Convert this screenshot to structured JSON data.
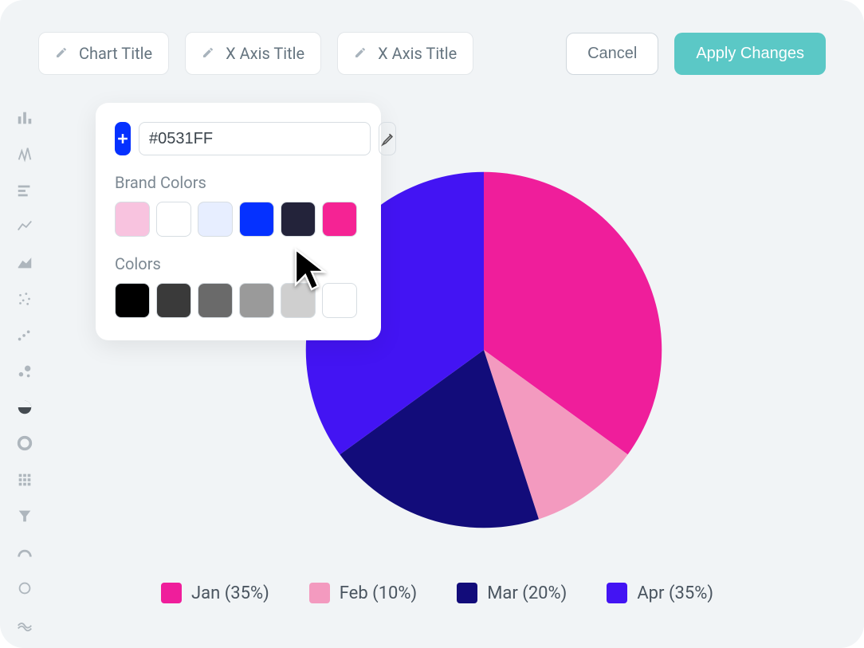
{
  "topbar": {
    "chart_title_placeholder": "Chart Title",
    "x_axis_title_placeholder": "X Axis Title",
    "x_axis_title_placeholder_2": "X Axis Title",
    "cancel_label": "Cancel",
    "apply_label": "Apply Changes"
  },
  "popover": {
    "hex_value": "#0531FF",
    "brand_colors_label": "Brand Colors",
    "brand_colors": [
      "#F8C3DF",
      "#FFFFFF",
      "#E7EEFF",
      "#0531FF",
      "#23233A",
      "#F52394"
    ],
    "colors_label": "Colors",
    "colors": [
      "#000000",
      "#3A3A3A",
      "#6A6A6A",
      "#9A9A9A",
      "#CFCFCF",
      "#FFFFFF"
    ]
  },
  "chart_data": {
    "type": "pie",
    "title": "",
    "series": [
      {
        "name": "Jan",
        "value": 35,
        "color": "#EF1E9B"
      },
      {
        "name": "Feb",
        "value": 10,
        "color": "#F39ABF"
      },
      {
        "name": "Mar",
        "value": 20,
        "color": "#120C7A"
      },
      {
        "name": "Apr",
        "value": 35,
        "color": "#4314F3"
      }
    ],
    "legend_format": "{name} ({value}%)"
  },
  "sidebar_icons": [
    "bar-chart-icon",
    "column-chart-icon",
    "horizontal-bar-icon",
    "line-chart-icon",
    "area-chart-icon",
    "scatter-dots-icon",
    "scatter-points-icon",
    "bubble-chart-icon",
    "pie-chart-icon",
    "donut-chart-icon",
    "matrix-icon",
    "funnel-icon",
    "gauge-icon",
    "ring-icon",
    "stream-icon"
  ]
}
